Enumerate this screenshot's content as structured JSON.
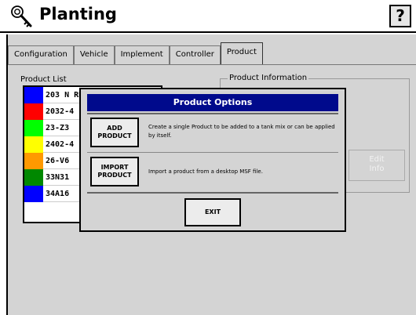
{
  "title": "Planting",
  "help_label": "?",
  "tabs": [
    {
      "label": "Configuration",
      "active": false
    },
    {
      "label": "Vehicle",
      "active": false
    },
    {
      "label": "Implement",
      "active": false
    },
    {
      "label": "Controller",
      "active": false
    },
    {
      "label": "Product",
      "active": true
    }
  ],
  "product_list": {
    "label": "Product List",
    "items": [
      {
        "name": "203 N RR",
        "color": "#0000ff"
      },
      {
        "name": "2032-4",
        "color": "#ff0000"
      },
      {
        "name": "23-Z3",
        "color": "#00ff00"
      },
      {
        "name": "2402-4",
        "color": "#ffff00"
      },
      {
        "name": "26-V6",
        "color": "#ff9900"
      },
      {
        "name": "33N31",
        "color": "#008800"
      },
      {
        "name": "34A16",
        "color": "#0000ff"
      }
    ]
  },
  "product_information": {
    "label": "Product Information",
    "edit_button": {
      "line1": "Edit",
      "line2": "Info"
    }
  },
  "modal": {
    "title": "Product Options",
    "add_button": {
      "line1": "ADD",
      "line2": "PRODUCT"
    },
    "add_description": "Create a single Product to be added to a tank mix or can be applied by itself.",
    "import_button": {
      "line1": "IMPORT",
      "line2": "PRODUCT"
    },
    "import_description": "Import a product from a desktop MSF file.",
    "exit_label": "EXIT"
  },
  "colors": {
    "header_blue": "#000a8c",
    "background_gray": "#d4d4d4"
  }
}
